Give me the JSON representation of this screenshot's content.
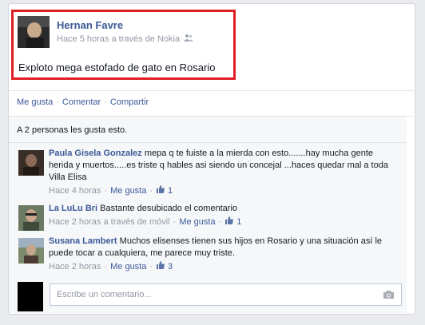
{
  "post": {
    "author": "Hernan Favre",
    "meta": "Hace 5 horas a través de Nokia",
    "text": "Exploto mega estofado de gato en Rosario"
  },
  "actions": {
    "like": "Me gusta",
    "comment": "Comentar",
    "share": "Compartir",
    "separator": "·"
  },
  "likes_summary": "A 2 personas les gusta esto.",
  "comments": [
    {
      "name": "Paula Gisela Gonzalez",
      "text": "mepa q te fuiste a la mierda con esto.......hay mucha gente herida y muertos.....es triste q hables asi siendo un concejal ...haces quedar mal a toda Villa Elisa",
      "time": "Hace 4 horas",
      "like": "Me gusta",
      "likes": "1"
    },
    {
      "name": "La LuLu Bri",
      "text": "Bastante desubicado el comentario",
      "time": "Hace 2 horas a través de móvil",
      "like": "Me gusta",
      "likes": "1"
    },
    {
      "name": "Susana Lambert",
      "text": "Muchos elisenses tienen sus hijos en Rosario y una situación así le puede tocar a cualquiera, me parece muy triste.",
      "time": "Hace 2 horas",
      "like": "Me gusta",
      "likes": "3"
    }
  ],
  "composer": {
    "placeholder": "Escribe un comentario..."
  },
  "colors": {
    "link": "#3b5998",
    "muted": "#9197a3",
    "highlight_border": "#e01e24"
  },
  "icons": [
    "friends-privacy-icon",
    "thumbs-up-icon",
    "camera-icon"
  ]
}
